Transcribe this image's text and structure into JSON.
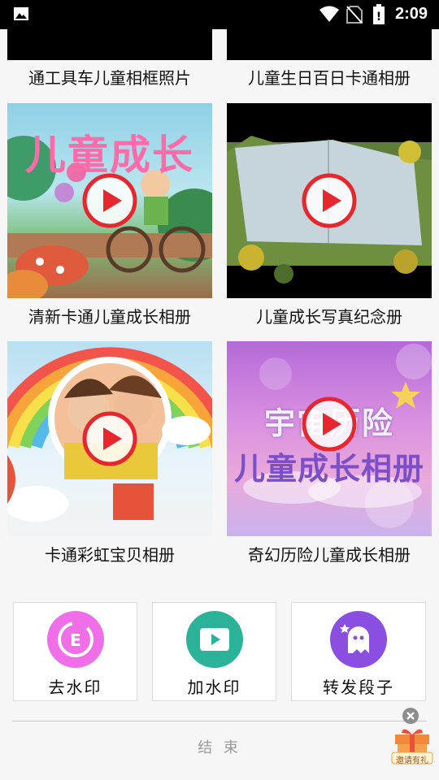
{
  "status_bar": {
    "time": "2:09"
  },
  "top_row": [
    {
      "caption": "通工具车儿童相框照片"
    },
    {
      "caption": "儿童生日百日卡通相册"
    }
  ],
  "albums": [
    {
      "caption": "清新卡通儿童成长相册",
      "thumb_text": "儿童成长"
    },
    {
      "caption": "儿童成长写真纪念册"
    },
    {
      "caption": "卡通彩虹宝贝相册"
    },
    {
      "caption": "奇幻历险儿童成长相册",
      "thumb_text_1": "宇宙历险",
      "thumb_text_2": "儿童成长相册"
    }
  ],
  "tools": [
    {
      "label": "去水印",
      "icon": "watermark-remove-icon",
      "color": "#f06fe8"
    },
    {
      "label": "加水印",
      "icon": "video-play-icon",
      "color": "#2bb39a"
    },
    {
      "label": "转发段子",
      "icon": "ghost-icon",
      "color": "#8a4fe0"
    }
  ],
  "footer": {
    "end_text": "结 束",
    "gift_label": "邀请有礼"
  },
  "colors": {
    "play_ring": "#e8262e",
    "background": "#f6f6f6"
  }
}
